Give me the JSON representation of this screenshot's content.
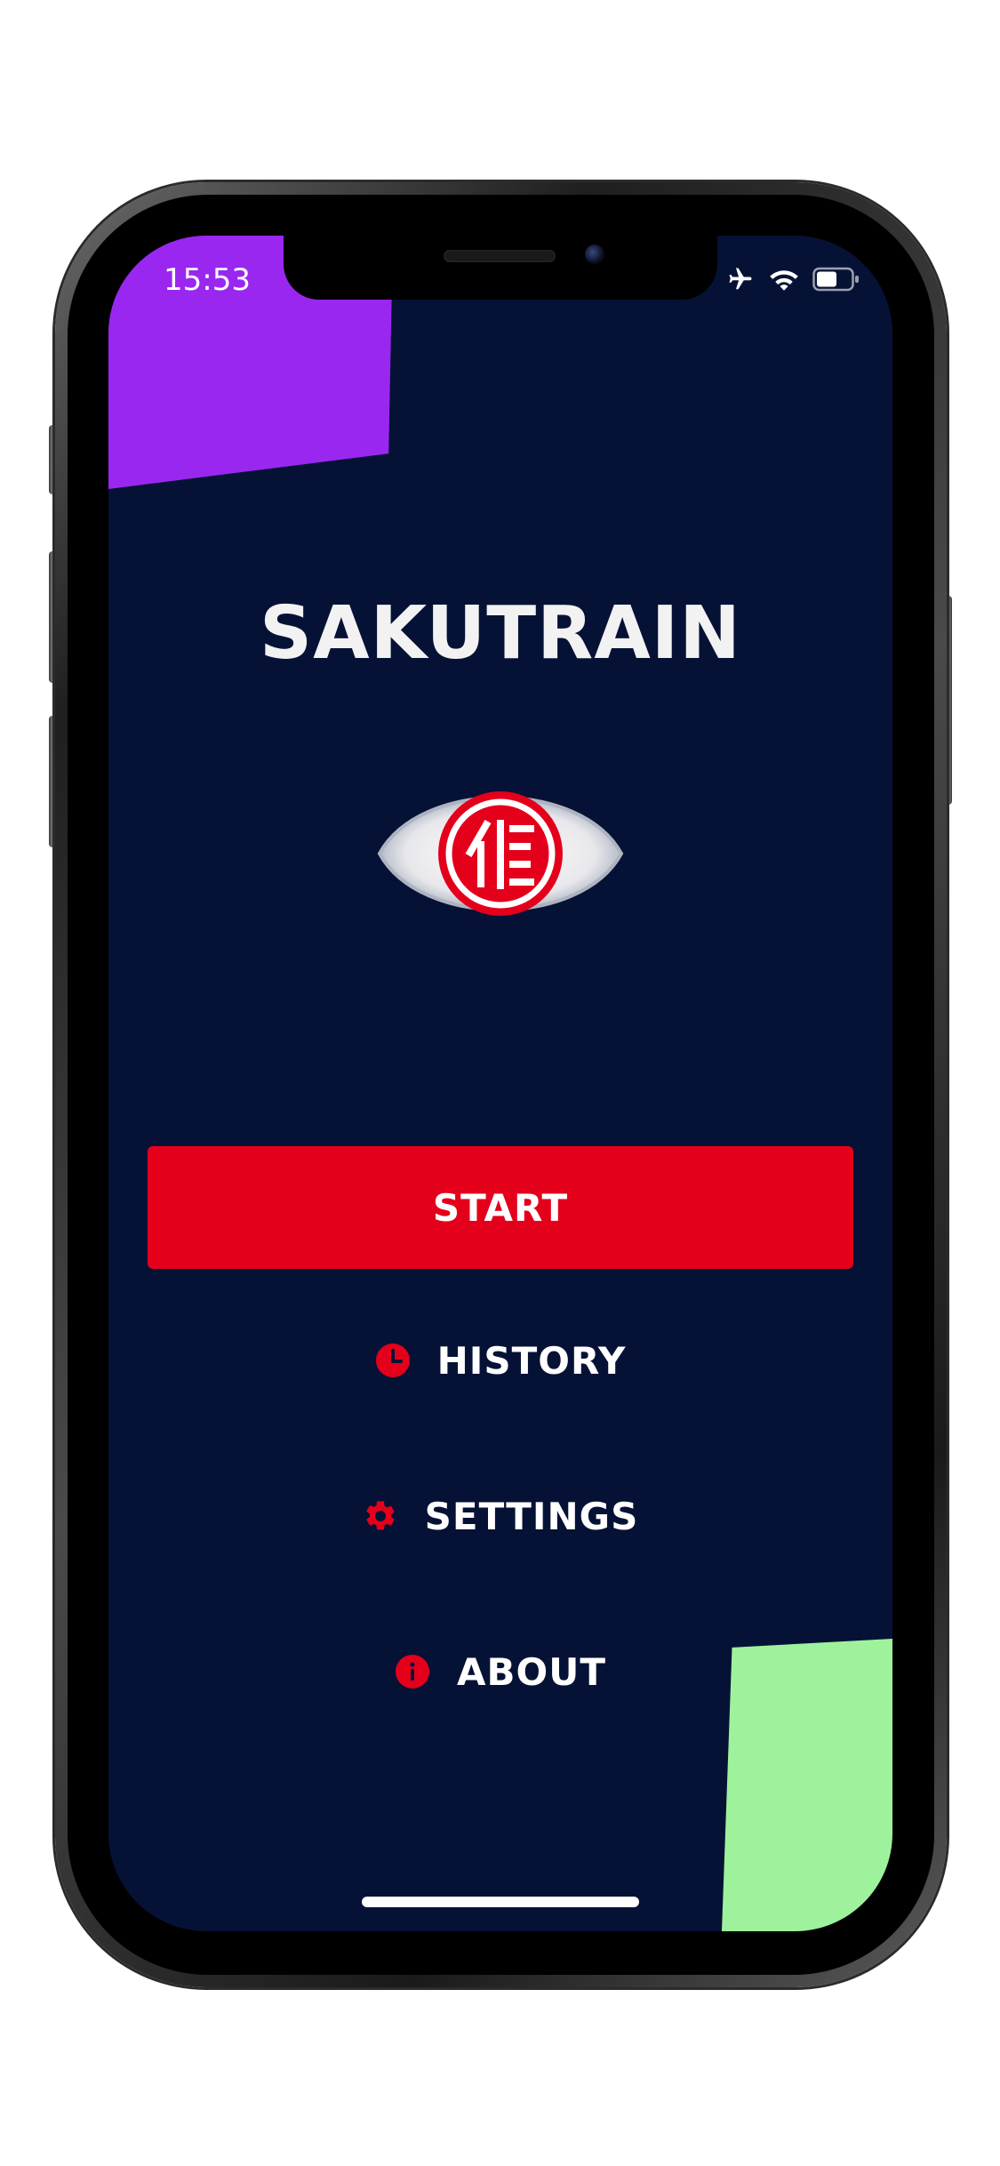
{
  "status_bar": {
    "time": "15:53",
    "icons": [
      "airplane-icon",
      "wifi-icon",
      "battery-icon"
    ]
  },
  "app": {
    "title": "SAKUTRAIN",
    "logo_icon": "eye-logo-icon"
  },
  "actions": {
    "start_label": "START"
  },
  "menu": {
    "items": [
      {
        "label": "HISTORY",
        "icon": "clock-icon"
      },
      {
        "label": "SETTINGS",
        "icon": "gear-icon"
      },
      {
        "label": "ABOUT",
        "icon": "info-icon"
      }
    ]
  },
  "colors": {
    "background": "#061235",
    "accent": "#e4001b",
    "deco_purple": "#9a27f0",
    "deco_green": "#9ef29c",
    "text": "#ffffff"
  }
}
